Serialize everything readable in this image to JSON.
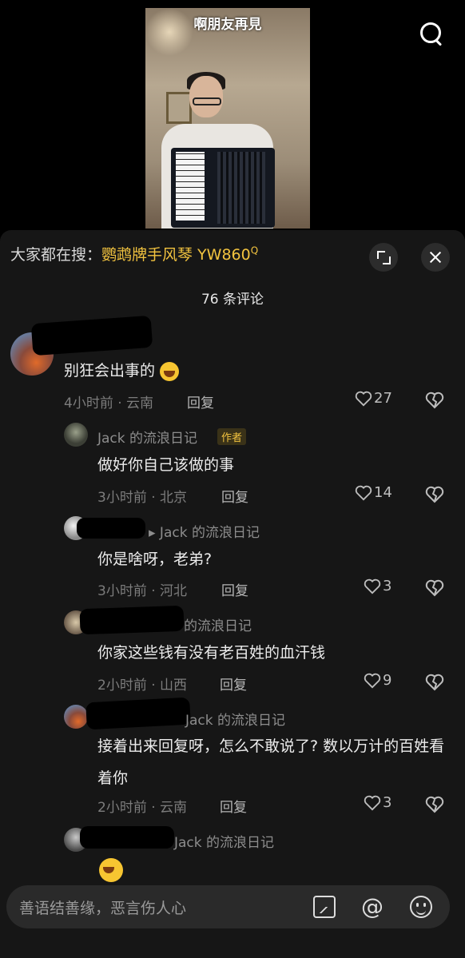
{
  "video": {
    "title": "啊朋友再見"
  },
  "header": {
    "search_prefix": "大家都在搜：",
    "search_term": "鹦鹉牌手风琴 YW860",
    "comment_count": "76 条评论"
  },
  "comments": [
    {
      "text": "别狂会出事的",
      "time": "4小时前 · 云南",
      "reply": "回复",
      "likes": "27"
    },
    {
      "name": "Jack 的流浪日记",
      "tag": "作者",
      "text": "做好你自己该做的事",
      "time": "3小时前 · 北京",
      "reply": "回复",
      "likes": "14"
    },
    {
      "name": "▸ Jack 的流浪日记",
      "text": "你是啥呀，老弟?",
      "time": "3小时前 · 河北",
      "reply": "回复",
      "likes": "3"
    },
    {
      "name": "的流浪日记",
      "text": "你家这些钱有没有老百姓的血汗钱",
      "time": "2小时前 · 山西",
      "reply": "回复",
      "likes": "9"
    },
    {
      "name": "Jack 的流浪日记",
      "text": "接着出来回复呀，怎么不敢说了? 数以万计的百姓看着你",
      "time": "2小时前 · 云南",
      "reply": "回复",
      "likes": "3"
    },
    {
      "name": "Jack 的流浪日记"
    }
  ],
  "input": {
    "placeholder": "善语结善缘，恶言伤人心"
  },
  "icons": [
    "search-icon",
    "expand-icon",
    "close-icon",
    "heart-icon",
    "broken-heart-icon",
    "image-icon",
    "at-icon",
    "emoji-icon"
  ],
  "colors": {
    "accent": "#f2c33f",
    "panel": "#161616",
    "background": "#000000"
  }
}
